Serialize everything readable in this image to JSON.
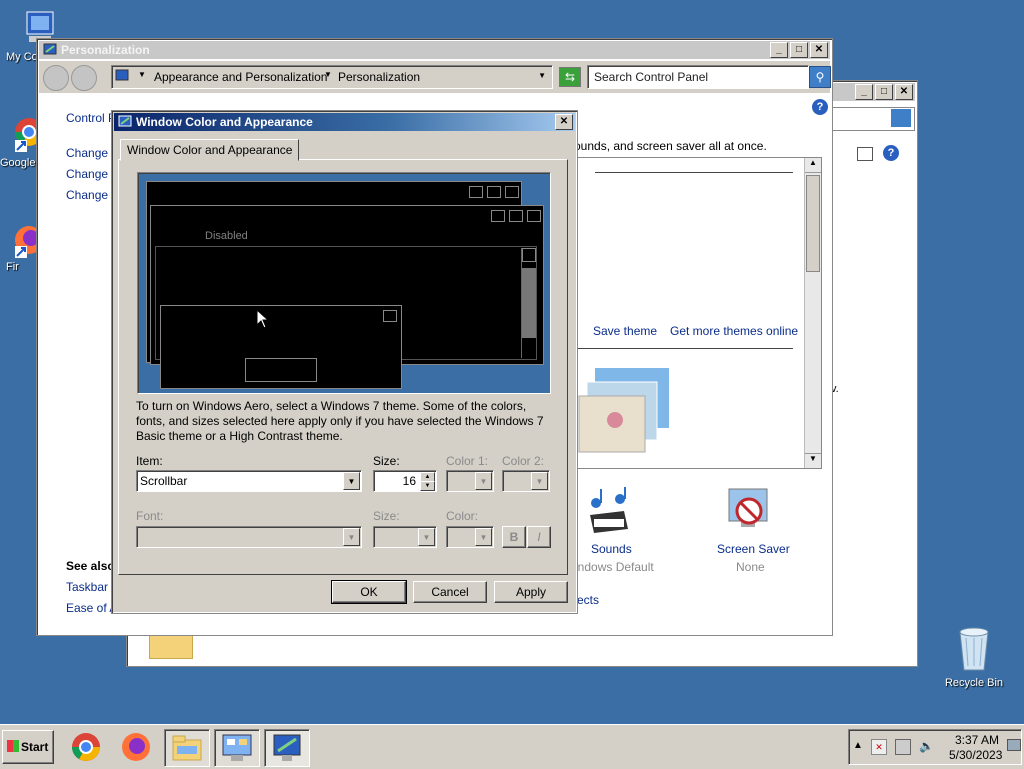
{
  "desktop": {
    "icons": [
      {
        "label": "My Co",
        "icon": "my-computer-icon"
      },
      {
        "label": "Google",
        "icon": "chrome-shortcut-icon"
      },
      {
        "label": "Fir",
        "icon": "firefox-shortcut-icon"
      },
      {
        "label": "Recycle Bin",
        "icon": "recycle-bin-icon"
      }
    ]
  },
  "personalization": {
    "title": "Personalization",
    "nav": {
      "crumb1": "Appearance and Personalization",
      "crumb2": "Personalization",
      "search_placeholder": "Search Control Panel"
    },
    "left": {
      "control_panel": "Control P",
      "links": [
        "Change d",
        "Change m",
        "Change y"
      ],
      "see_also": "See also",
      "see_also_links": [
        "Taskbar a",
        "Ease of A"
      ]
    },
    "main": {
      "desc": "ounds, and screen saver all at once.",
      "save_theme": "Save theme",
      "more_themes": "Get more themes online",
      "sounds": {
        "label": "Sounds",
        "sub": "indows Default"
      },
      "screen_saver": {
        "label": "Screen Saver",
        "sub": "None"
      },
      "effects_fragment": "ects"
    }
  },
  "background_window": {
    "fragment": "v."
  },
  "dialog": {
    "title": "Window Color and Appearance",
    "tab": "Window Color and Appearance",
    "preview": {
      "disabled_label": "Disabled"
    },
    "info": "To turn on Windows Aero, select a Windows 7 theme.  Some of the colors, fonts, and sizes selected here apply only if you have selected the Windows 7 Basic theme or a High Contrast theme.",
    "item_label": "Item:",
    "item_value": "Scrollbar",
    "size_label": "Size:",
    "size_value": "16",
    "color1_label": "Color 1:",
    "color2_label": "Color 2:",
    "font_label": "Font:",
    "font_size_label": "Size:",
    "font_color_label": "Color:",
    "bold_label": "B",
    "italic_label": "I",
    "ok": "OK",
    "cancel": "Cancel",
    "apply": "Apply"
  },
  "taskbar": {
    "start": "Start",
    "items": [
      "chrome-icon",
      "firefox-icon",
      "explorer-icon",
      "control-panel-icon",
      "personalization-icon"
    ],
    "time": "3:37 AM",
    "date": "5/30/2023"
  },
  "colors": {
    "desktop": "#3a6ea5",
    "active_title": "#0a246a",
    "inactive_title": "#c8c8c8",
    "link": "#0a2d8a"
  }
}
